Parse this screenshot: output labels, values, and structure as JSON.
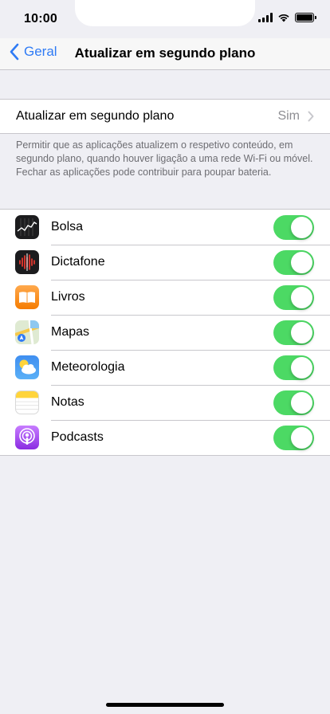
{
  "status": {
    "time": "10:00"
  },
  "nav": {
    "back_label": "Geral",
    "title": "Atualizar em segundo plano"
  },
  "main_setting": {
    "label": "Atualizar em segundo plano",
    "value": "Sim"
  },
  "footnote": "Permitir que as aplicações atualizem o respetivo conteúdo, em segundo plano, quando houver ligação a uma rede Wi-Fi ou móvel. Fechar as aplicações pode contribuir para poupar bateria.",
  "apps": [
    {
      "name": "Bolsa",
      "icon": "stocks-icon",
      "enabled": true
    },
    {
      "name": "Dictafone",
      "icon": "voice-memos-icon",
      "enabled": true
    },
    {
      "name": "Livros",
      "icon": "books-icon",
      "enabled": true
    },
    {
      "name": "Mapas",
      "icon": "maps-icon",
      "enabled": true
    },
    {
      "name": "Meteorologia",
      "icon": "weather-icon",
      "enabled": true
    },
    {
      "name": "Notas",
      "icon": "notes-icon",
      "enabled": true
    },
    {
      "name": "Podcasts",
      "icon": "podcasts-icon",
      "enabled": true
    }
  ],
  "colors": {
    "accent": "#2f7bf5",
    "toggle_on": "#4cd964",
    "background": "#efeff4"
  }
}
